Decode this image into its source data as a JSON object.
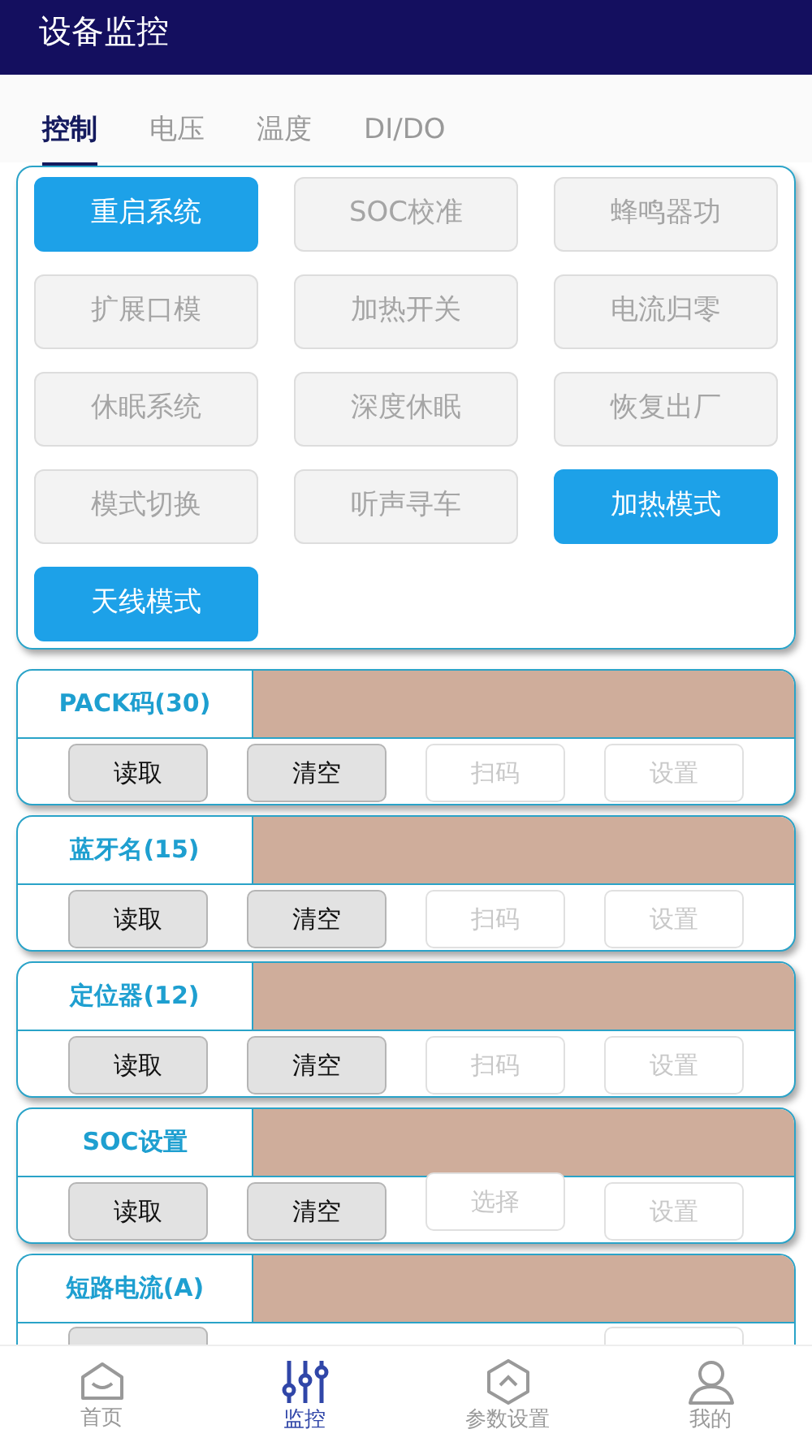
{
  "header": {
    "title": "设备监控"
  },
  "tabs": [
    {
      "label": "控制",
      "selected": true
    },
    {
      "label": "电压",
      "selected": false
    },
    {
      "label": "温度",
      "selected": false
    },
    {
      "label": "DI/DO",
      "selected": false
    }
  ],
  "controls": [
    {
      "label": "重启系统",
      "active": true
    },
    {
      "label": "SOC校准",
      "active": false
    },
    {
      "label": "蜂鸣器功",
      "active": false
    },
    {
      "label": "扩展口模",
      "active": false
    },
    {
      "label": "加热开关",
      "active": false
    },
    {
      "label": "电流归零",
      "active": false
    },
    {
      "label": "休眠系统",
      "active": false
    },
    {
      "label": "深度休眠",
      "active": false
    },
    {
      "label": "恢复出厂",
      "active": false
    },
    {
      "label": "模式切换",
      "active": false
    },
    {
      "label": "听声寻车",
      "active": false
    },
    {
      "label": "加热模式",
      "active": true
    },
    {
      "label": "天线模式",
      "active": true
    }
  ],
  "params": [
    {
      "label": "PACK码(30)",
      "buttons": [
        {
          "kind": "read",
          "label": "读取",
          "enabled": true
        },
        {
          "kind": "clear",
          "label": "清空",
          "enabled": true
        },
        {
          "kind": "pick",
          "label": "扫码",
          "enabled": false
        },
        {
          "kind": "set",
          "label": "设置",
          "enabled": false
        }
      ]
    },
    {
      "label": "蓝牙名(15)",
      "buttons": [
        {
          "kind": "read",
          "label": "读取",
          "enabled": true
        },
        {
          "kind": "clear",
          "label": "清空",
          "enabled": true
        },
        {
          "kind": "pick",
          "label": "扫码",
          "enabled": false
        },
        {
          "kind": "set",
          "label": "设置",
          "enabled": false
        }
      ]
    },
    {
      "label": "定位器(12)",
      "buttons": [
        {
          "kind": "read",
          "label": "读取",
          "enabled": true
        },
        {
          "kind": "clear",
          "label": "清空",
          "enabled": true
        },
        {
          "kind": "pick",
          "label": "扫码",
          "enabled": false
        },
        {
          "kind": "set",
          "label": "设置",
          "enabled": false
        }
      ]
    },
    {
      "label": "SOC设置",
      "buttons": [
        {
          "kind": "read",
          "label": "读取",
          "enabled": true
        },
        {
          "kind": "clear",
          "label": "清空",
          "enabled": true
        },
        {
          "kind": "pick",
          "label": "选择",
          "enabled": false
        },
        {
          "kind": "set",
          "label": "设置",
          "enabled": false
        }
      ]
    },
    {
      "label": "短路电流(A)",
      "buttons": [
        {
          "kind": "read",
          "enabled": true
        },
        {
          "kind": "set",
          "enabled": false
        }
      ]
    }
  ],
  "bottom_nav": [
    {
      "label": "首页",
      "kind": "home",
      "selected": false
    },
    {
      "label": "监控",
      "kind": "monitor",
      "selected": true
    },
    {
      "label": "参数设置",
      "kind": "params",
      "selected": false
    },
    {
      "label": "我的",
      "kind": "me",
      "selected": false
    }
  ]
}
